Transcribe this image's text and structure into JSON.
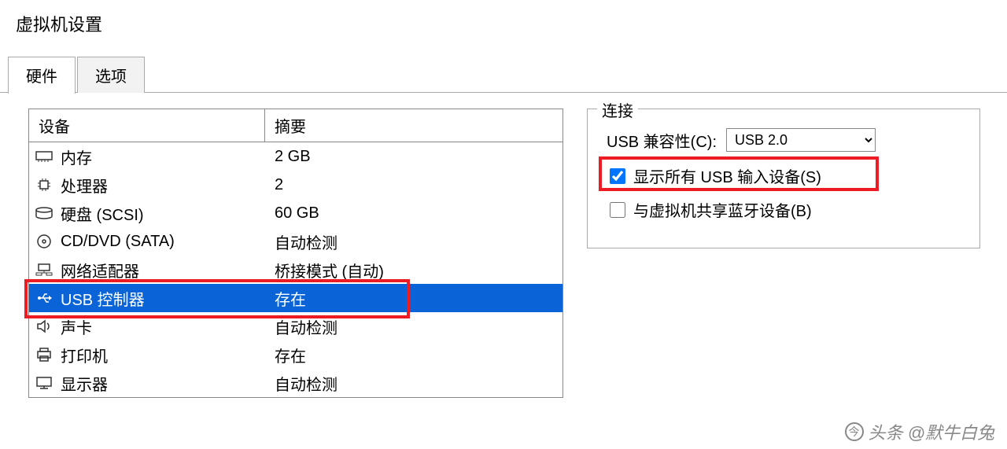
{
  "window": {
    "title": "虚拟机设置"
  },
  "tabs": {
    "hardware": "硬件",
    "options": "选项"
  },
  "columns": {
    "device": "设备",
    "summary": "摘要"
  },
  "devices": {
    "memory": {
      "name": "内存",
      "summary": "2 GB"
    },
    "cpu": {
      "name": "处理器",
      "summary": "2"
    },
    "disk": {
      "name": "硬盘 (SCSI)",
      "summary": "60 GB"
    },
    "cddvd": {
      "name": "CD/DVD (SATA)",
      "summary": "自动检测"
    },
    "network": {
      "name": "网络适配器",
      "summary": "桥接模式 (自动)"
    },
    "usb": {
      "name": "USB 控制器",
      "summary": "存在"
    },
    "sound": {
      "name": "声卡",
      "summary": "自动检测"
    },
    "printer": {
      "name": "打印机",
      "summary": "存在"
    },
    "display": {
      "name": "显示器",
      "summary": "自动检测"
    }
  },
  "connection": {
    "group_title": "连接",
    "compat_label": "USB 兼容性(C):",
    "compat_value": "USB 2.0",
    "show_all_label": "显示所有 USB 输入设备(S)",
    "share_bt_label": "与虚拟机共享蓝牙设备(B)"
  },
  "watermark": "头条 @默牛白兔"
}
